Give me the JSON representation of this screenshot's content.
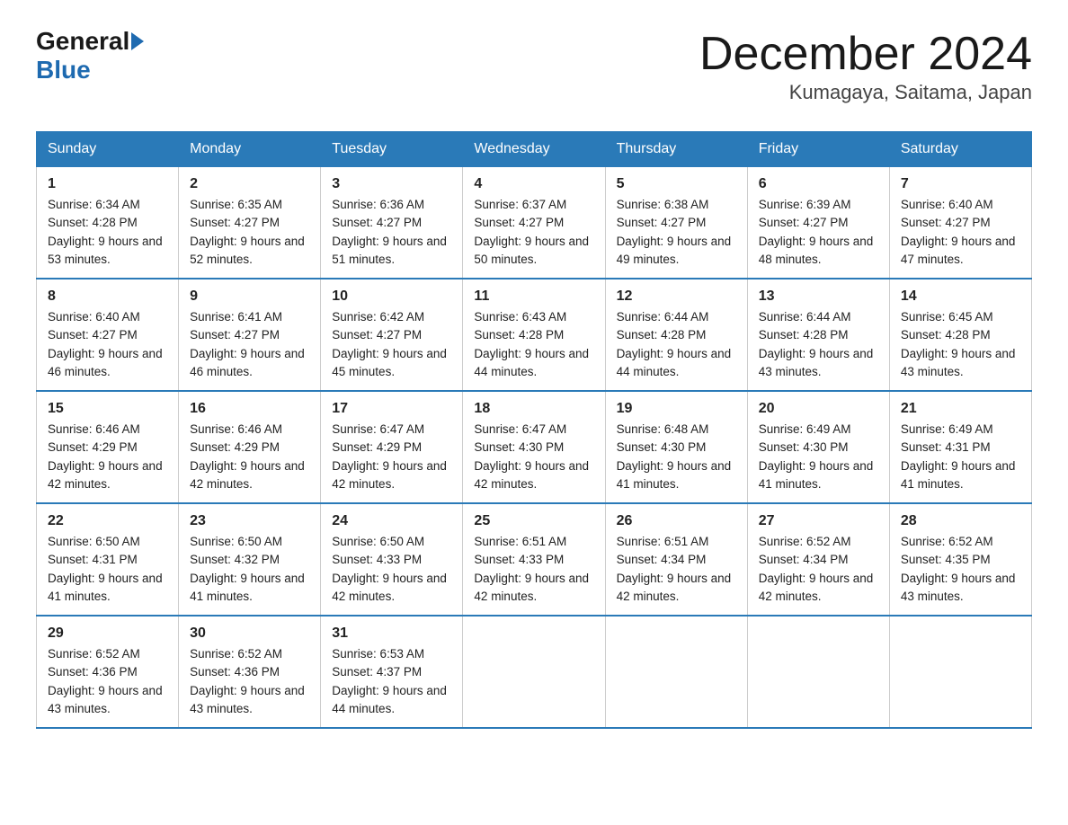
{
  "header": {
    "logo_general": "General",
    "logo_blue": "Blue",
    "title": "December 2024",
    "location": "Kumagaya, Saitama, Japan"
  },
  "days_of_week": [
    "Sunday",
    "Monday",
    "Tuesday",
    "Wednesday",
    "Thursday",
    "Friday",
    "Saturday"
  ],
  "weeks": [
    [
      {
        "day": "1",
        "sunrise": "6:34 AM",
        "sunset": "4:28 PM",
        "daylight": "9 hours and 53 minutes."
      },
      {
        "day": "2",
        "sunrise": "6:35 AM",
        "sunset": "4:27 PM",
        "daylight": "9 hours and 52 minutes."
      },
      {
        "day": "3",
        "sunrise": "6:36 AM",
        "sunset": "4:27 PM",
        "daylight": "9 hours and 51 minutes."
      },
      {
        "day": "4",
        "sunrise": "6:37 AM",
        "sunset": "4:27 PM",
        "daylight": "9 hours and 50 minutes."
      },
      {
        "day": "5",
        "sunrise": "6:38 AM",
        "sunset": "4:27 PM",
        "daylight": "9 hours and 49 minutes."
      },
      {
        "day": "6",
        "sunrise": "6:39 AM",
        "sunset": "4:27 PM",
        "daylight": "9 hours and 48 minutes."
      },
      {
        "day": "7",
        "sunrise": "6:40 AM",
        "sunset": "4:27 PM",
        "daylight": "9 hours and 47 minutes."
      }
    ],
    [
      {
        "day": "8",
        "sunrise": "6:40 AM",
        "sunset": "4:27 PM",
        "daylight": "9 hours and 46 minutes."
      },
      {
        "day": "9",
        "sunrise": "6:41 AM",
        "sunset": "4:27 PM",
        "daylight": "9 hours and 46 minutes."
      },
      {
        "day": "10",
        "sunrise": "6:42 AM",
        "sunset": "4:27 PM",
        "daylight": "9 hours and 45 minutes."
      },
      {
        "day": "11",
        "sunrise": "6:43 AM",
        "sunset": "4:28 PM",
        "daylight": "9 hours and 44 minutes."
      },
      {
        "day": "12",
        "sunrise": "6:44 AM",
        "sunset": "4:28 PM",
        "daylight": "9 hours and 44 minutes."
      },
      {
        "day": "13",
        "sunrise": "6:44 AM",
        "sunset": "4:28 PM",
        "daylight": "9 hours and 43 minutes."
      },
      {
        "day": "14",
        "sunrise": "6:45 AM",
        "sunset": "4:28 PM",
        "daylight": "9 hours and 43 minutes."
      }
    ],
    [
      {
        "day": "15",
        "sunrise": "6:46 AM",
        "sunset": "4:29 PM",
        "daylight": "9 hours and 42 minutes."
      },
      {
        "day": "16",
        "sunrise": "6:46 AM",
        "sunset": "4:29 PM",
        "daylight": "9 hours and 42 minutes."
      },
      {
        "day": "17",
        "sunrise": "6:47 AM",
        "sunset": "4:29 PM",
        "daylight": "9 hours and 42 minutes."
      },
      {
        "day": "18",
        "sunrise": "6:47 AM",
        "sunset": "4:30 PM",
        "daylight": "9 hours and 42 minutes."
      },
      {
        "day": "19",
        "sunrise": "6:48 AM",
        "sunset": "4:30 PM",
        "daylight": "9 hours and 41 minutes."
      },
      {
        "day": "20",
        "sunrise": "6:49 AM",
        "sunset": "4:30 PM",
        "daylight": "9 hours and 41 minutes."
      },
      {
        "day": "21",
        "sunrise": "6:49 AM",
        "sunset": "4:31 PM",
        "daylight": "9 hours and 41 minutes."
      }
    ],
    [
      {
        "day": "22",
        "sunrise": "6:50 AM",
        "sunset": "4:31 PM",
        "daylight": "9 hours and 41 minutes."
      },
      {
        "day": "23",
        "sunrise": "6:50 AM",
        "sunset": "4:32 PM",
        "daylight": "9 hours and 41 minutes."
      },
      {
        "day": "24",
        "sunrise": "6:50 AM",
        "sunset": "4:33 PM",
        "daylight": "9 hours and 42 minutes."
      },
      {
        "day": "25",
        "sunrise": "6:51 AM",
        "sunset": "4:33 PM",
        "daylight": "9 hours and 42 minutes."
      },
      {
        "day": "26",
        "sunrise": "6:51 AM",
        "sunset": "4:34 PM",
        "daylight": "9 hours and 42 minutes."
      },
      {
        "day": "27",
        "sunrise": "6:52 AM",
        "sunset": "4:34 PM",
        "daylight": "9 hours and 42 minutes."
      },
      {
        "day": "28",
        "sunrise": "6:52 AM",
        "sunset": "4:35 PM",
        "daylight": "9 hours and 43 minutes."
      }
    ],
    [
      {
        "day": "29",
        "sunrise": "6:52 AM",
        "sunset": "4:36 PM",
        "daylight": "9 hours and 43 minutes."
      },
      {
        "day": "30",
        "sunrise": "6:52 AM",
        "sunset": "4:36 PM",
        "daylight": "9 hours and 43 minutes."
      },
      {
        "day": "31",
        "sunrise": "6:53 AM",
        "sunset": "4:37 PM",
        "daylight": "9 hours and 44 minutes."
      },
      null,
      null,
      null,
      null
    ]
  ]
}
